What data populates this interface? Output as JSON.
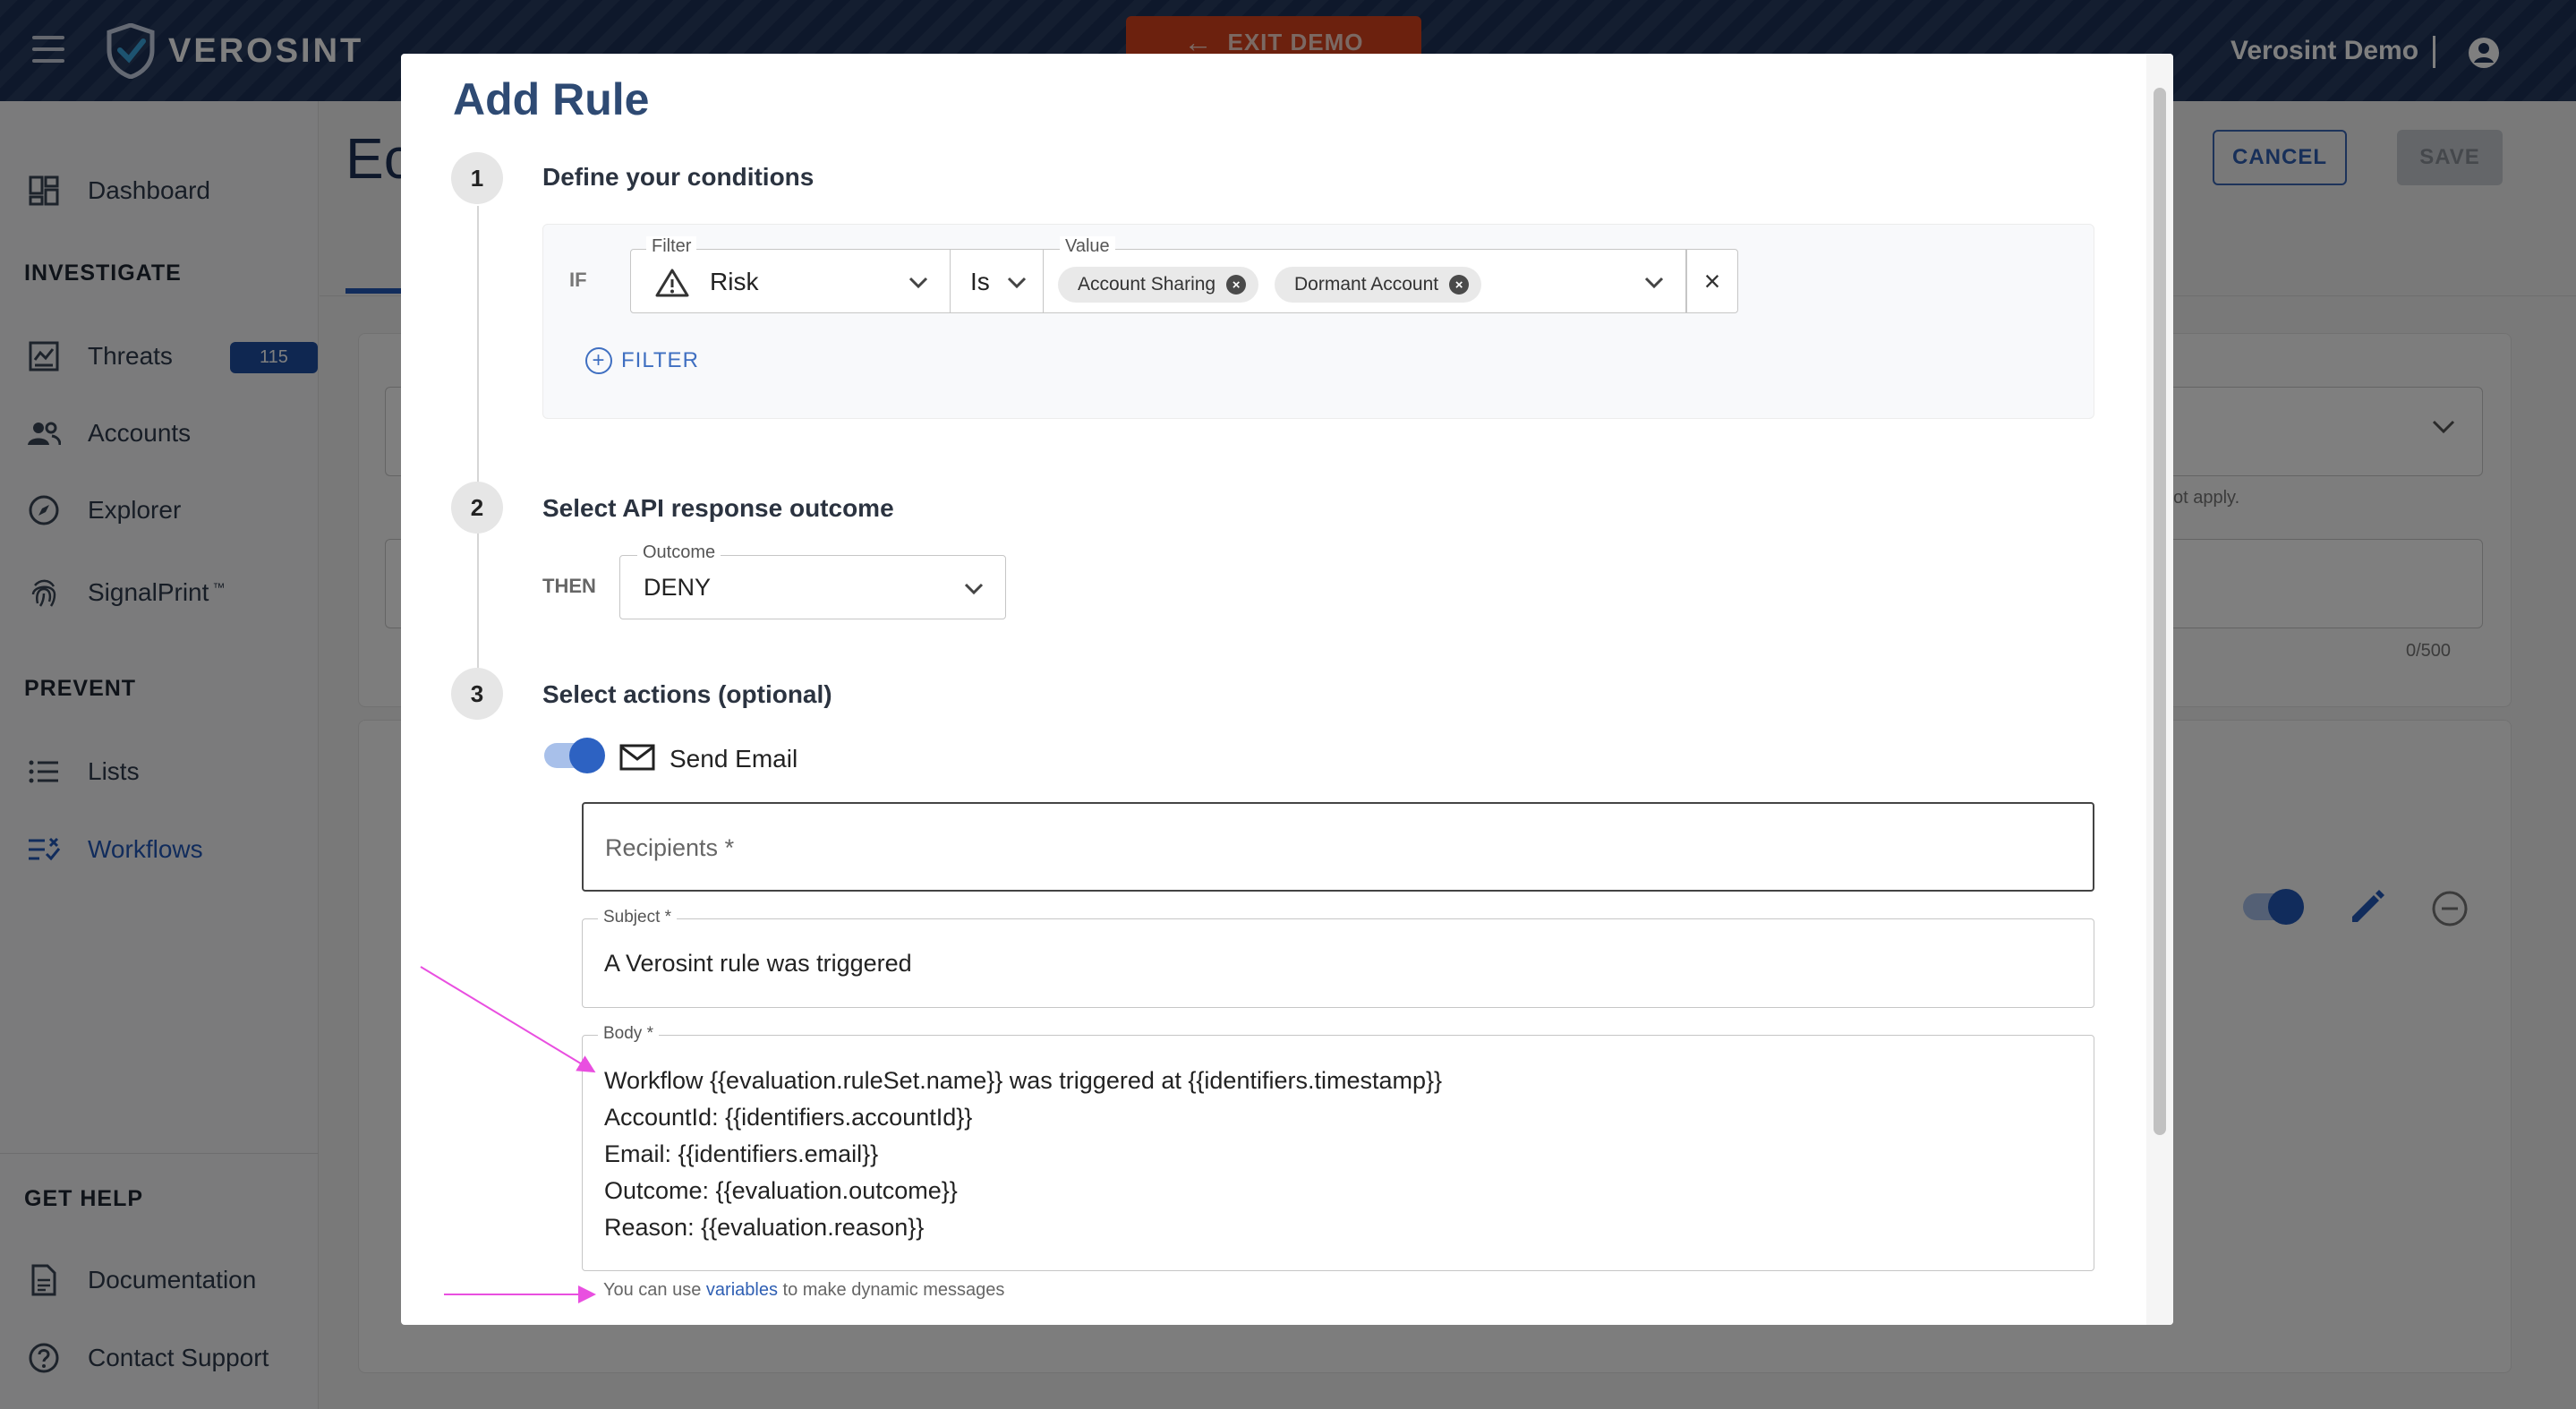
{
  "topbar": {
    "brand": "VEROSINT",
    "exit_demo": "EXIT DEMO",
    "user_name": "Verosint Demo",
    "colors": {
      "bar": "#1d3157",
      "exit": "#d8421c"
    }
  },
  "sidebar": {
    "dashboard": "Dashboard",
    "investigate": "INVESTIGATE",
    "threats": "Threats",
    "threats_badge": "115",
    "accounts": "Accounts",
    "explorer": "Explorer",
    "signalprint": "SignalPrint",
    "signalprint_tm": "™",
    "prevent": "PREVENT",
    "lists": "Lists",
    "workflows": "Workflows",
    "get_help": "GET HELP",
    "documentation": "Documentation",
    "contact_support": "Contact Support"
  },
  "background": {
    "title": "Ec",
    "cancel": "CANCEL",
    "save": "SAVE",
    "hint": "ot apply.",
    "count": "0/500"
  },
  "modal": {
    "title": "Add Rule",
    "step1": {
      "number": "1",
      "heading": "Define your conditions",
      "if_label": "IF",
      "filter_label": "Filter",
      "filter_value": "Risk",
      "operator": "Is",
      "value_label": "Value",
      "chips": [
        "Account Sharing",
        "Dormant Account"
      ],
      "chip_remove": "×",
      "clear": "×",
      "add_filter": "FILTER",
      "add_filter_plus": "+"
    },
    "step2": {
      "number": "2",
      "heading": "Select API response outcome",
      "then_label": "THEN",
      "outcome_label": "Outcome",
      "outcome_value": "DENY"
    },
    "step3": {
      "number": "3",
      "heading": "Select actions (optional)",
      "send_email": "Send Email",
      "recipients_placeholder": "Recipients *",
      "subject_label": "Subject *",
      "subject_value": "A Verosint rule was triggered",
      "body_label": "Body *",
      "body_lines": [
        "Workflow {{evaluation.ruleSet.name}} was triggered at {{identifiers.timestamp}}",
        "AccountId: {{identifiers.accountId}}",
        "Email: {{identifiers.email}}",
        "Outcome: {{evaluation.outcome}}",
        "Reason: {{evaluation.reason}}"
      ],
      "helper_prefix": "You can use ",
      "helper_link": "variables",
      "helper_suffix": " to make dynamic messages"
    }
  },
  "accent": "#2358b8",
  "annotation_color": "#e94fe0"
}
